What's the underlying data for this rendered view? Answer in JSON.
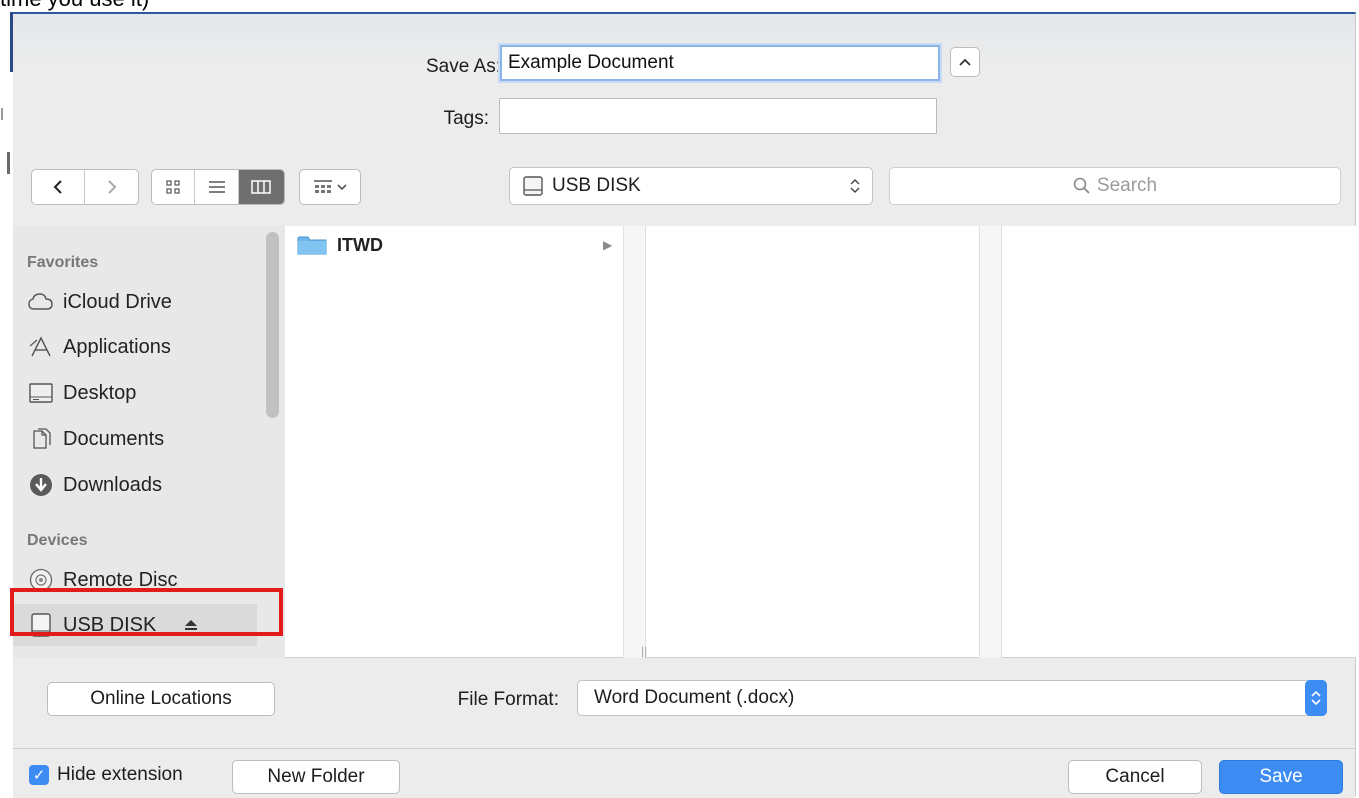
{
  "doc_text": "time you use it)",
  "save_as": {
    "label": "Save As:",
    "value": "Example Document"
  },
  "tags": {
    "label": "Tags:",
    "value": ""
  },
  "location": {
    "name": "USB DISK"
  },
  "search": {
    "placeholder": "Search"
  },
  "sidebar": {
    "favorites_header": "Favorites",
    "favorites": [
      {
        "label": "iCloud Drive",
        "icon": "cloud-icon"
      },
      {
        "label": "Applications",
        "icon": "applications-icon"
      },
      {
        "label": "Desktop",
        "icon": "desktop-icon"
      },
      {
        "label": "Documents",
        "icon": "documents-icon"
      },
      {
        "label": "Downloads",
        "icon": "downloads-icon"
      }
    ],
    "devices_header": "Devices",
    "devices": [
      {
        "label": "Remote Disc",
        "icon": "disc-icon"
      },
      {
        "label": "USB DISK",
        "icon": "drive-icon"
      }
    ]
  },
  "files": [
    {
      "name": "ITWD",
      "icon": "folder-icon"
    }
  ],
  "bottom": {
    "online_locations": "Online Locations",
    "file_format_label": "File Format:",
    "file_format_value": "Word Document (.docx)",
    "hide_extension": "Hide extension",
    "new_folder": "New Folder",
    "cancel": "Cancel",
    "save": "Save"
  },
  "colors": {
    "accent": "#3d8cf3",
    "highlight": "#e21b1b"
  }
}
